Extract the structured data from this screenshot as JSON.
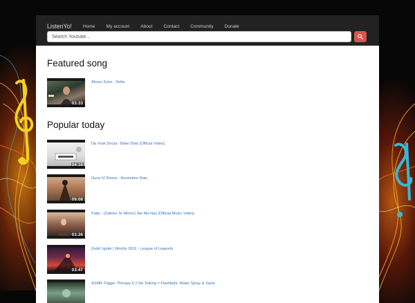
{
  "navbar": {
    "brand": "ListenYo!",
    "links": [
      "Home",
      "My account",
      "About",
      "Contact",
      "Community",
      "Donate"
    ]
  },
  "search": {
    "placeholder": "Search Youtube..."
  },
  "featured": {
    "heading": "Featured song",
    "items": [
      {
        "title": "Alvaro Soler - Sofia",
        "duration": "03:33"
      }
    ]
  },
  "popular": {
    "heading": "Popular today",
    "items": [
      {
        "title": "Da Vosk Docta - Biale Zloto [Official Video]",
        "duration": "04:16"
      },
      {
        "title": "Guns N' Roses - November Rain",
        "duration": "09:08"
      },
      {
        "title": "Patty - (Zabiles Te Milosc) Nie Ma Nas [Official Music Video]",
        "duration": "03:26"
      },
      {
        "title": "Zedd: Ignite | Worlds 2016 - League of Legends",
        "duration": "03:47"
      },
      {
        "title": "ASMR Trigger Therapy 6.1 No Talking = Flashlight, Water Spray & Sand",
        "duration": ""
      }
    ]
  },
  "colors": {
    "navbar_bg": "#222222",
    "link": "#3a73b5",
    "search_button": "#d9534f",
    "page_bg": "#070707"
  },
  "icons": {
    "search_button": "search-icon"
  }
}
